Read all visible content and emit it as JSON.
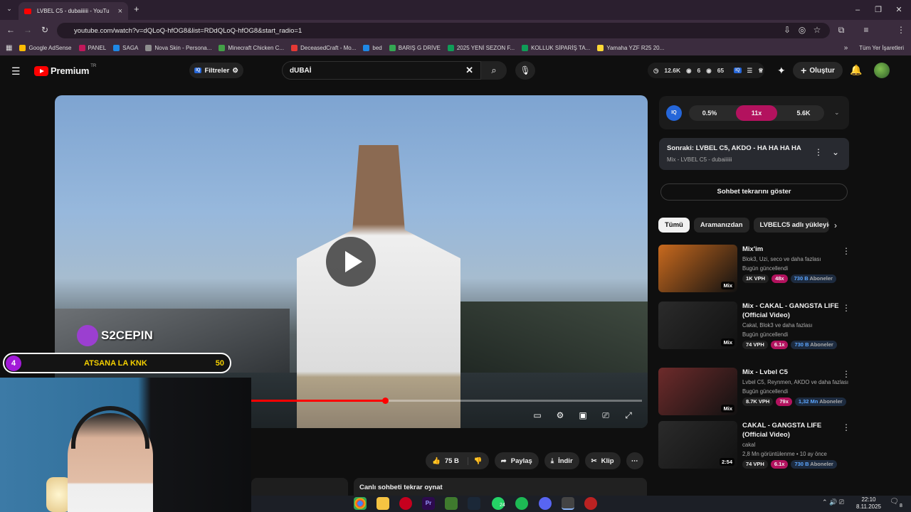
{
  "browser": {
    "tab_title": "LVBEL C5 - dubaiiiiii - YouTu",
    "url": "youtube.com/watch?v=dQLoQ-hfOG8&list=RDdQLoQ-hfOG8&start_radio=1",
    "bookmarks": [
      {
        "label": "Google AdSense",
        "color": "#fbbc04"
      },
      {
        "label": "PANEL",
        "color": "#c2185b"
      },
      {
        "label": "SAGA",
        "color": "#1e88e5"
      },
      {
        "label": "Nova Skin - Persona...",
        "color": "#8e8e8e"
      },
      {
        "label": "Minecraft Chicken C...",
        "color": "#43a047"
      },
      {
        "label": "DeceasedCraft - Mo...",
        "color": "#e53935"
      },
      {
        "label": "bed",
        "color": "#1e88e5"
      },
      {
        "label": "BARIŞ G DRİVE",
        "color": "#34a853"
      },
      {
        "label": "2025 YENİ SEZON F...",
        "color": "#0f9d58"
      },
      {
        "label": "KOLLUK SİPARİŞ TA...",
        "color": "#0f9d58"
      },
      {
        "label": "Yamaha YZF R25 20...",
        "color": "#fdd835"
      }
    ],
    "all_bookmarks": "Tüm Yer İşaretleri"
  },
  "yt": {
    "logo": "Premium",
    "region": "TR",
    "filters": "Filtreler",
    "search_value": "dUBAİ",
    "stats": {
      "views": "12.6K",
      "a": "6",
      "b": "65"
    },
    "create": "Oluştur"
  },
  "overlay": {
    "brand": "S2CEPIN",
    "count_left": "4",
    "message": "ATSANA LA KNK",
    "count_right": "50"
  },
  "actions": {
    "likes": "75 B",
    "share": "Paylaş",
    "download": "İndir",
    "clip": "Klip"
  },
  "chat_replay": "Canlı sohbeti tekrar oynat",
  "iq": {
    "label": "IQ",
    "p1": "0.5%",
    "p2": "11x",
    "p3": "5.6K"
  },
  "next": {
    "title": "Sonraki: LVBEL C5, AKDO - HA HA HA HA",
    "sub": "Mix - LVBEL C5 - dubaiiiiii"
  },
  "chat_button": "Sohbet tekrarını göster",
  "chips": [
    "Tümü",
    "Aramanızdan",
    "LVBELC5 adlı yükleyicide"
  ],
  "recs": [
    {
      "title": "Mix'im",
      "sub1": "Blok3, Uzi, seco ve daha fazlası",
      "sub2": "Bugün güncellendi",
      "badge": "Mix",
      "vph": "1K VPH",
      "mult": "48x",
      "subs": "730 B",
      "subs_label": "Aboneler",
      "thumb": "#c96a1e"
    },
    {
      "title": "Mix - CAKAL - GANGSTA LIFE (Official Video)",
      "sub1": "Cakal, Blok3 ve daha fazlası",
      "sub2": "Bugün güncellendi",
      "badge": "Mix",
      "vph": "74 VPH",
      "mult": "6.1x",
      "subs": "730 B",
      "subs_label": "Aboneler",
      "thumb": "#2b2b2b"
    },
    {
      "title": "Mix - Lvbel C5",
      "sub1": "Lvbel C5, Reynmen, AKDO ve daha fazlası",
      "sub2": "Bugün güncellendi",
      "badge": "Mix",
      "vph": "8.7K VPH",
      "mult": "79x",
      "subs": "1,32 Mn",
      "subs_label": "Aboneler",
      "thumb": "#6e2b2b"
    },
    {
      "title": "CAKAL - GANGSTA LIFE (Official Video)",
      "sub1": "cakal",
      "sub2": "2,8 Mn görüntülenme • 10 ay önce",
      "badge": "2:54",
      "vph": "74 VPH",
      "mult": "6.1x",
      "subs": "730 B",
      "subs_label": "Aboneler",
      "thumb": "#2b2b2b"
    }
  ],
  "taskbar": {
    "time": "22:10",
    "date": "8.11.2025",
    "wa_badge": "24",
    "notif": "8"
  }
}
